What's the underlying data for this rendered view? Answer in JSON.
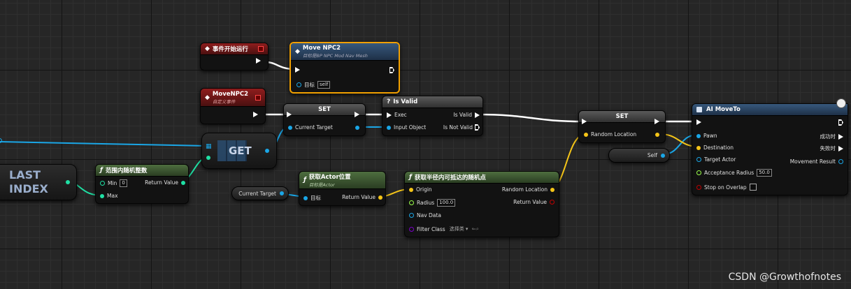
{
  "colors": {
    "exec": "#ffffff",
    "object": "#1aa6e6",
    "int": "#1fe0a4",
    "vector": "#f5c518",
    "float": "#9aff4a",
    "bool": "#8a0000",
    "struct": "#3a8dff",
    "class": "#7a00c8"
  },
  "nodes": {
    "event_start": {
      "title": "事件开始运行"
    },
    "move_npc2_call": {
      "title": "Move NPC2",
      "subtitle": "目标是BP NPC Mod Nav Mesh",
      "target_label": "目标",
      "target_value": "self"
    },
    "custom_event": {
      "title": "MoveNPC2",
      "subtitle": "自定义事件"
    },
    "set1": {
      "title": "SET",
      "pin_current_target": "Current Target"
    },
    "is_valid": {
      "title": "Is Valid",
      "pin_exec": "Exec",
      "pin_input_object": "Input Object",
      "pin_is_valid": "Is Valid",
      "pin_is_not_valid": "Is Not Valid"
    },
    "get": {
      "title": "GET"
    },
    "last_index": {
      "line1": "LAST",
      "line2": "INDEX"
    },
    "random_int": {
      "title": "范围内随机整数",
      "pin_min": "Min",
      "min_value": "0",
      "pin_max": "Max",
      "pin_return": "Return Value"
    },
    "current_target_pill1": {
      "label": "Current Target"
    },
    "get_actor_location": {
      "title": "获取Actor位置",
      "subtitle": "目标是Actor",
      "pin_target": "目标",
      "pin_return": "Return Value"
    },
    "random_reachable": {
      "title": "获取半径内可抵达的随机点",
      "pin_origin": "Origin",
      "pin_radius": "Radius",
      "radius_value": "100.0",
      "pin_nav_data": "Nav Data",
      "pin_filter_class": "Filter Class",
      "filter_value": "选择类 ▾",
      "pin_random_location": "Random Location",
      "pin_return": "Return Value"
    },
    "set2": {
      "title": "SET",
      "pin_random_location": "Random Location"
    },
    "self_pill": {
      "label": "Self"
    },
    "ai_move_to": {
      "title": "AI MoveTo",
      "pin_pawn": "Pawn",
      "pin_destination": "Destination",
      "pin_target_actor": "Target Actor",
      "pin_acceptance_radius": "Acceptance Radius",
      "acceptance_value": "50.0",
      "pin_stop_on_overlap": "Stop on Overlap",
      "pin_on_success": "成功时",
      "pin_on_fail": "失败时",
      "pin_movement_result": "Movement Result"
    }
  },
  "watermark": "CSDN @Growthofnotes"
}
